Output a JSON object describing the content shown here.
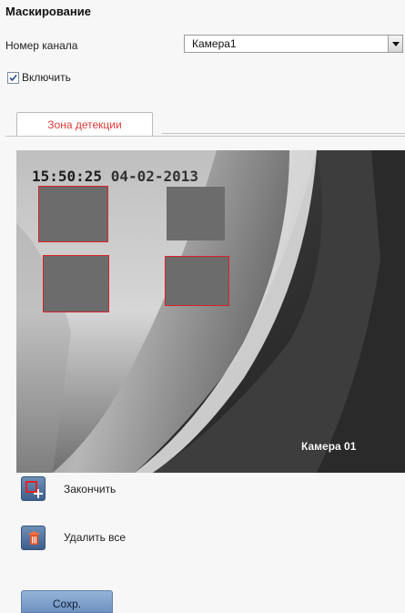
{
  "page": {
    "title": "Маскирование",
    "channel_label": "Номер канала",
    "channel_value": "Камера1",
    "enable_label": "Включить",
    "enable_checked": true
  },
  "tabs": [
    {
      "label": "Зона детекции",
      "active": true
    }
  ],
  "video": {
    "osd_time": "15:50:25 ",
    "osd_date": "04-02-2013",
    "osd_camera": "Камера 01",
    "masks": [
      {
        "name": "mask-1",
        "outlined": true
      },
      {
        "name": "mask-2",
        "outlined": false
      },
      {
        "name": "mask-3",
        "outlined": true
      },
      {
        "name": "mask-4",
        "outlined": true
      }
    ]
  },
  "actions": {
    "finish_label": "Закончить",
    "delete_all_label": "Удалить все",
    "save_label": "Сохр."
  },
  "colors": {
    "accent_red": "#e23a3a",
    "mask_outline": "#d8222a",
    "button_blue": "#4a6b98"
  }
}
